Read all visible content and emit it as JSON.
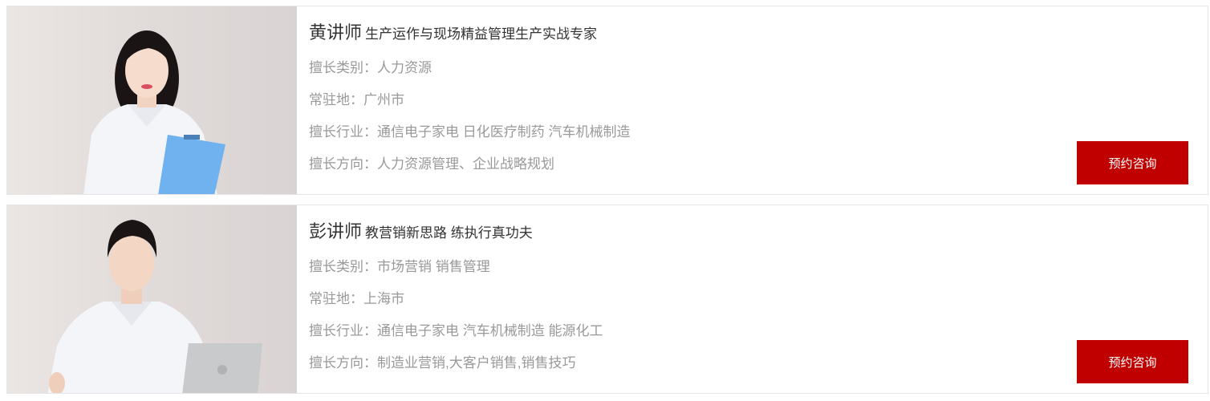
{
  "lecturers": [
    {
      "name": "黄讲师",
      "tagline": "生产运作与现场精益管理生产实战专家",
      "category": "擅长类别：人力资源",
      "location": "常驻地：广州市",
      "industry": "擅长行业：通信电子家电 日化医疗制药 汽车机械制造",
      "direction": "擅长方向：人力资源管理、企业战略规划",
      "button": "预约咨询"
    },
    {
      "name": "彭讲师",
      "tagline": "教营销新思路 练执行真功夫",
      "category": "擅长类别：市场营销 销售管理",
      "location": "常驻地：上海市",
      "industry": "擅长行业：通信电子家电 汽车机械制造 能源化工",
      "direction": "擅长方向：制造业营销,大客户销售,销售技巧",
      "button": "预约咨询"
    }
  ],
  "colors": {
    "accent": "#c00000",
    "name_text": "#333333",
    "meta_text": "#999999",
    "border": "#e6e6e6"
  }
}
